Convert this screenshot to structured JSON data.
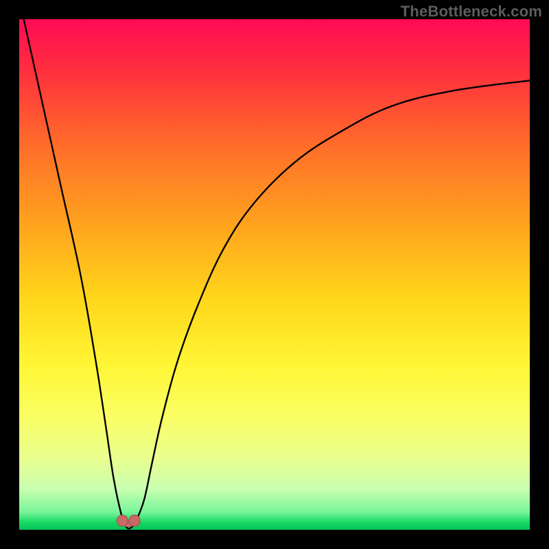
{
  "watermark": "TheBottleneck.com",
  "colors": {
    "frame": "#000000",
    "curve": "#000000",
    "marker": "#c96a66",
    "gradient_top": "#ff0a56",
    "gradient_mid": "#ffe23a",
    "gradient_bottom": "#05c25a"
  },
  "chart_data": {
    "type": "line",
    "title": "",
    "xlabel": "",
    "ylabel": "",
    "xlim": [
      0,
      100
    ],
    "ylim": [
      0,
      100
    ],
    "grid": false,
    "legend": false,
    "series": [
      {
        "name": "bottleneck-curve",
        "x": [
          0,
          4,
          8,
          12,
          15,
          17,
          18.5,
          20,
          21,
          22,
          23,
          24.5,
          26,
          28,
          31,
          35,
          40,
          46,
          54,
          63,
          73,
          85,
          100
        ],
        "y": [
          104,
          86,
          68,
          50,
          33,
          20,
          10,
          3,
          0.5,
          0.5,
          2,
          6,
          13,
          22,
          33,
          44,
          55,
          64,
          72,
          78,
          83,
          86,
          88
        ]
      }
    ],
    "markers": [
      {
        "x": 20.2,
        "y": 1.8
      },
      {
        "x": 22.6,
        "y": 1.8
      }
    ],
    "annotations": []
  }
}
